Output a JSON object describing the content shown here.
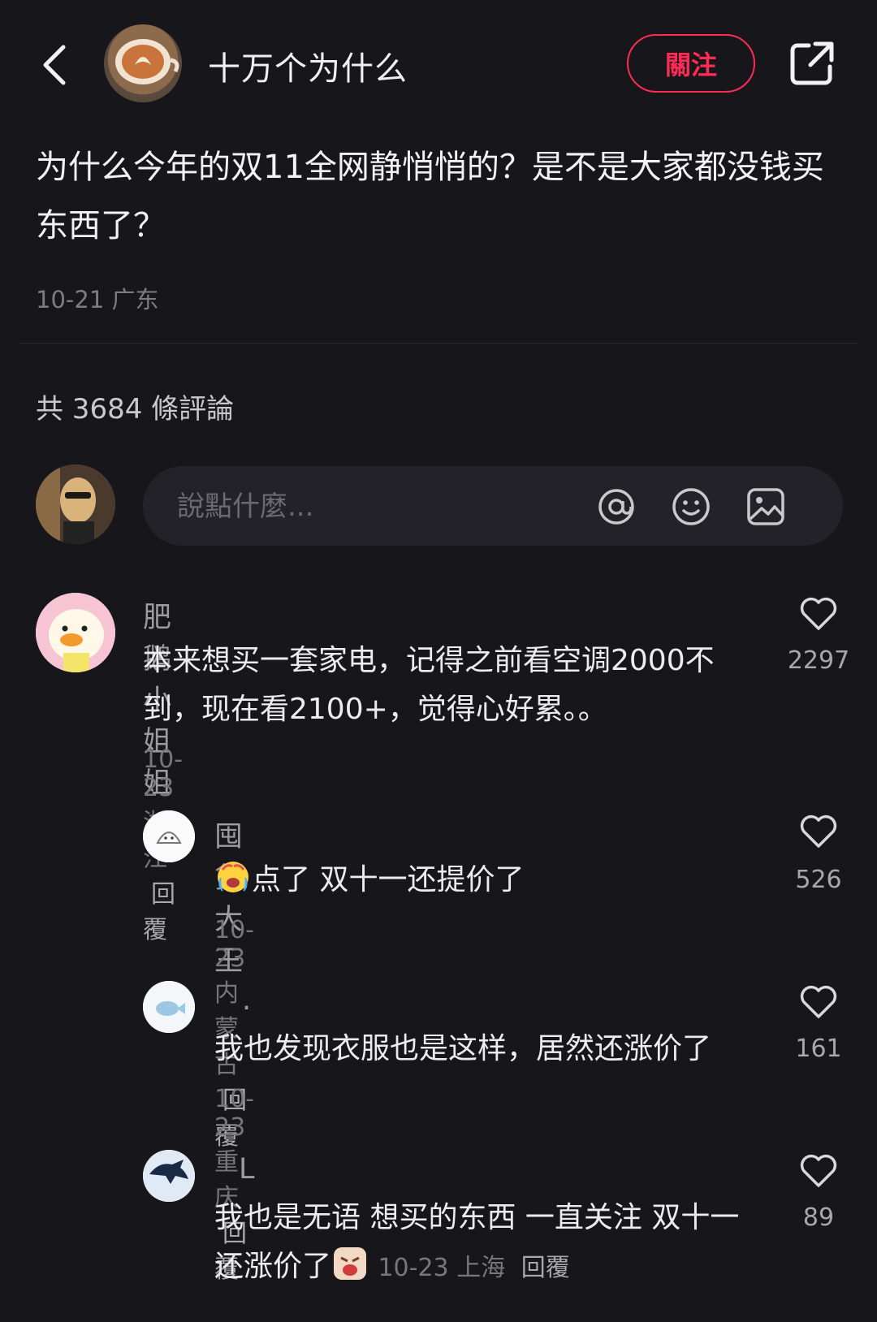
{
  "header": {
    "author_name": "十万个为什么",
    "follow_label": "關注"
  },
  "post": {
    "title": "为什么今年的双11全网静悄悄的？是不是大家都没钱买东西了？",
    "date": "10-21",
    "location": "广东"
  },
  "comments_section": {
    "count_label": "共 3684 條評論",
    "input_placeholder": "說點什麼..."
  },
  "comments": [
    {
      "author": "肥鹅小姐姐",
      "text": "本来想买一套家电，记得之前看空调2000不到，现在看2100+，觉得心好累。。",
      "date": "10-23",
      "location": "浙江",
      "reply_label": "回覆",
      "likes": "2297"
    }
  ],
  "replies": [
    {
      "author": "囤货大王",
      "text": "点了 双十一还提价了",
      "date": "10-23",
      "location": "内蒙古",
      "reply_label": "回覆",
      "likes": "526",
      "emoji": "crying-face"
    },
    {
      "author": ".",
      "text": "我也发现衣服也是这样，居然还涨价了",
      "date": "10-23",
      "location": "重庆",
      "reply_label": "回覆",
      "likes": "161"
    },
    {
      "author": "L",
      "text": "我也是无语 想买的东西 一直关注 双十一还涨价了",
      "date": "10-23",
      "location": "上海",
      "reply_label": "回覆",
      "likes": "89",
      "emoji": "angry-face"
    }
  ],
  "icons": {
    "back": "chevron-left-icon",
    "share": "share-external-icon",
    "mention": "at-icon",
    "emoji": "smiley-icon",
    "image": "image-icon",
    "like": "heart-outline-icon"
  },
  "colors": {
    "background": "#17161b",
    "accent": "#ff2b54"
  }
}
